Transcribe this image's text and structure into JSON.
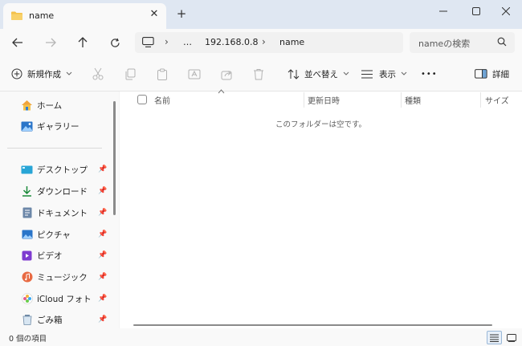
{
  "tab": {
    "title": "name",
    "close": "✕",
    "new_tab": "+"
  },
  "window": {
    "minimize": "—",
    "maximize": "☐",
    "close": "✕"
  },
  "address": {
    "crumbs": [
      "…",
      "192.168.0.8",
      "name"
    ],
    "separator": "›"
  },
  "search": {
    "placeholder": "nameの検索"
  },
  "commands": {
    "new": "新規作成",
    "sort": "並べ替え",
    "view": "表示",
    "more": "•••",
    "details": "詳細"
  },
  "sidebar": {
    "quick": [
      {
        "label": "ホーム",
        "icon": "home-icon"
      },
      {
        "label": "ギャラリー",
        "icon": "gallery-icon"
      }
    ],
    "pinned": [
      {
        "label": "デスクトップ",
        "icon": "desktop-icon"
      },
      {
        "label": "ダウンロード",
        "icon": "download-icon"
      },
      {
        "label": "ドキュメント",
        "icon": "document-icon"
      },
      {
        "label": "ピクチャ",
        "icon": "picture-icon"
      },
      {
        "label": "ビデオ",
        "icon": "video-icon"
      },
      {
        "label": "ミュージック",
        "icon": "music-icon"
      },
      {
        "label": "iCloud フォト",
        "icon": "icloud-photos-icon"
      },
      {
        "label": "ごみ箱",
        "icon": "recycle-bin-icon"
      }
    ]
  },
  "columns": {
    "name": "名前",
    "modified": "更新日時",
    "type": "種類",
    "size": "サイズ"
  },
  "empty_message": "このフォルダーは空です。",
  "status": {
    "count": "0 個の項目"
  },
  "colors": {
    "accent": "#005fb8",
    "folder": "#f3c14b",
    "titlebar": "#dfe7f2"
  }
}
